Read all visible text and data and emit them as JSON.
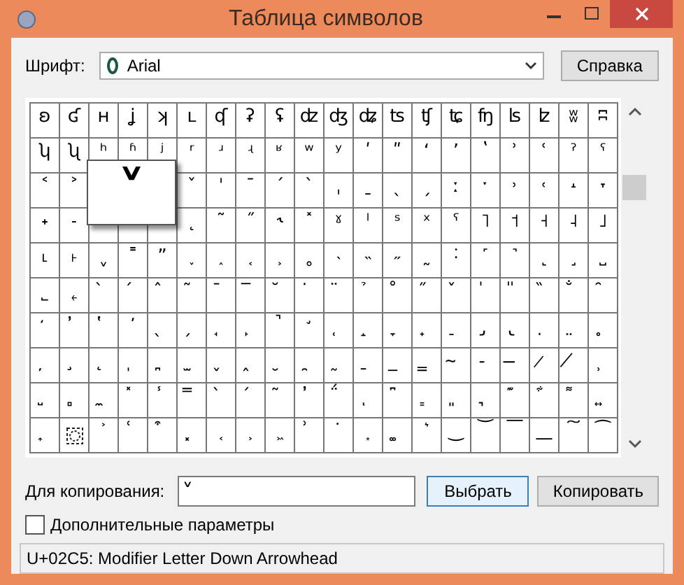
{
  "window": {
    "title": "Таблица символов"
  },
  "font_row": {
    "label": "Шрифт:",
    "value": "Arial",
    "help_button": "Справка"
  },
  "grid": {
    "rows": [
      [
        "ʚ",
        "ʛ",
        "ʜ",
        "ʝ",
        "ʞ",
        "ʟ",
        "ʠ",
        "ʡ",
        "ʢ",
        "ʣ",
        "ʤ",
        "ʥ",
        "ʦ",
        "ʧ",
        "ʨ",
        "ʩ",
        "ʪ",
        "ʫ",
        "ʬ",
        "ʭ"
      ],
      [
        "ʮ",
        "ʯ",
        "ʰ",
        "ʱ",
        "ʲ",
        "ʳ",
        "ʴ",
        "ʵ",
        "ʶ",
        "ʷ",
        "ʸ",
        "ʹ",
        "ʺ",
        "ʻ",
        "ʼ",
        "ʽ",
        "ʾ",
        "ʿ",
        "ˀ",
        "ˁ"
      ],
      [
        "˂",
        "˃",
        null,
        null,
        null,
        "ˇ",
        "ˈ",
        "ˉ",
        "ˊ",
        "ˋ",
        "ˌ",
        "ˍ",
        "ˎ",
        "ˏ",
        "ː",
        "ˑ",
        "˒",
        "˓",
        "˔",
        "˕"
      ],
      [
        "˖",
        "˗",
        null,
        null,
        null,
        "˛",
        "˜",
        "˝",
        "˞",
        "˟",
        "ˠ",
        "ˡ",
        "ˢ",
        "ˣ",
        "ˤ",
        "˥",
        "˦",
        "˧",
        "˨",
        "˩"
      ],
      [
        "˪",
        "˫",
        "ˬ",
        "˭",
        "ˮ",
        "˯",
        "˰",
        "˱",
        "˲",
        "˳",
        "˴",
        "˵",
        "˶",
        "˷",
        "˸",
        "˹",
        "˺",
        "˻",
        "˼",
        "˽"
      ],
      [
        "˾",
        "˿",
        "̀",
        "́",
        "̂",
        "̃",
        "̄",
        "̅",
        "̆",
        "̇",
        "̈",
        "̉",
        "̊",
        "̋",
        "̌",
        "̍",
        "̎",
        "̏",
        "̐",
        "̑"
      ],
      [
        "̒",
        "̓",
        "̔",
        "̕",
        "̖",
        "̗",
        "̘",
        "̙",
        "̚",
        "̛",
        "̜",
        "̝",
        "̞",
        "̟",
        "̠",
        "̡",
        "̢",
        "̣",
        "̤",
        "̥"
      ],
      [
        "̦",
        "̧",
        "̨",
        "̩",
        "̪",
        "̫",
        "̬",
        "̭",
        "̮",
        "̯",
        "̰",
        "̱",
        "̲",
        "̳",
        "̴",
        "̵",
        "̶",
        "̷",
        "̸",
        "̹"
      ],
      [
        "̺",
        "̻",
        "̼",
        "̽",
        "̾",
        "̿",
        "̀",
        "́",
        "͂",
        "̓",
        "̈́",
        "ͅ",
        "͆",
        "͇",
        "͈",
        "͉",
        "͊",
        "͋",
        "͌",
        "͍"
      ],
      [
        "͎",
        {
          "kind": "invisible"
        },
        "͐",
        "͑",
        "͒",
        "͓",
        "͔",
        "͕",
        "͖",
        "͗",
        "͘",
        "͙",
        "͚",
        "͛",
        "͜",
        "͝",
        "͞",
        "͟",
        "͠",
        "͡"
      ]
    ],
    "magnifier": {
      "char": "˅"
    }
  },
  "copy_row": {
    "label": "Для копирования:",
    "value": "˅",
    "select_button": "Выбрать",
    "copy_button": "Копировать"
  },
  "advanced": {
    "label": "Дополнительные параметры",
    "checked": false
  },
  "status_bar": "U+02C5: Modifier Letter Down Arrowhead"
}
